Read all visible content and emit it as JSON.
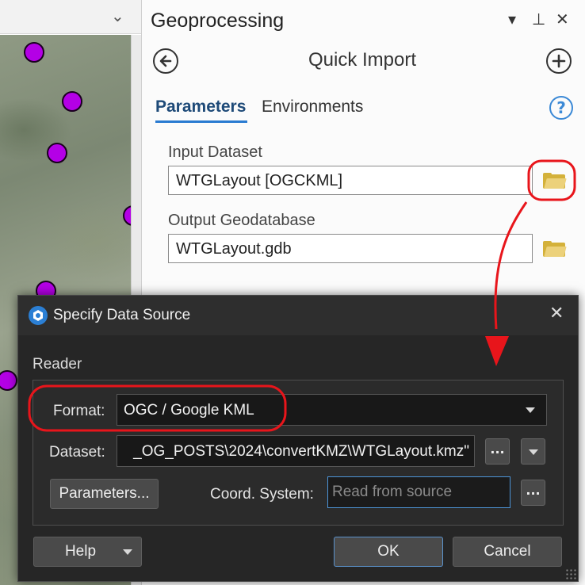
{
  "map": {
    "point_color": "#b400e6"
  },
  "geoprocessing": {
    "title": "Geoprocessing",
    "controls": {
      "menu": "▾",
      "pin": "⊥",
      "close": "✕"
    },
    "tool_title": "Quick Import",
    "tabs": [
      {
        "label": "Parameters",
        "active": true
      },
      {
        "label": "Environments",
        "active": false
      }
    ],
    "help_label": "?",
    "params": [
      {
        "label": "Input Dataset",
        "value": "WTGLayout [OGCKML]"
      },
      {
        "label": "Output Geodatabase",
        "value": "WTGLayout.gdb"
      }
    ],
    "accent_color": "#2a7bd1"
  },
  "dialog": {
    "title": "Specify Data Source",
    "close": "✕",
    "group_label": "Reader",
    "format_label": "Format:",
    "format_value": "OGC / Google KML",
    "dataset_label": "Dataset:",
    "dataset_value": "_OG_POSTS\\2024\\convertKMZ\\WTGLayout.kmz\"",
    "browse_label": "...",
    "parameters_button": "Parameters...",
    "coord_label": "Coord. System:",
    "coord_placeholder": "Read from source",
    "help_button": "Help",
    "ok_button": "OK",
    "cancel_button": "Cancel"
  },
  "annotation_color": "#e8151b"
}
